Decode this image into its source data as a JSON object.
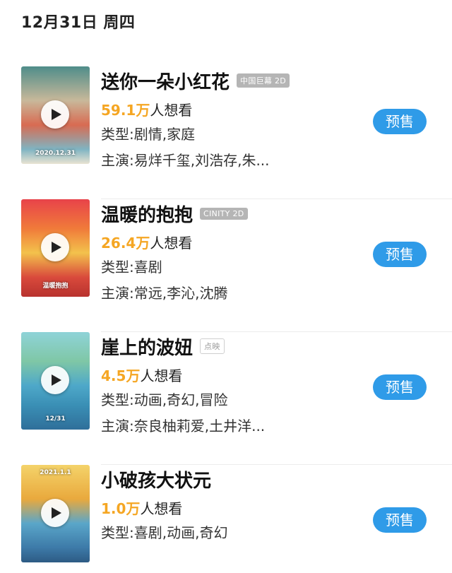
{
  "header": {
    "date": "12月31日 周四"
  },
  "movies": [
    {
      "title": "送你一朵小红花",
      "format": "中国巨幕 2D",
      "want_count": "59.1万",
      "want_suffix": "人想看",
      "genre": "类型:剧情,家庭",
      "cast": "主演:易烊千玺,刘浩存,朱...",
      "button": "预售",
      "poster_caption": "2020.12.31"
    },
    {
      "title": "温暖的抱抱",
      "format": "CINITY 2D",
      "want_count": "26.4万",
      "want_suffix": "人想看",
      "genre": "类型:喜剧",
      "cast": "主演:常远,李沁,沈腾",
      "button": "预售",
      "poster_caption": "温暖抱抱"
    },
    {
      "title": "崖上的波妞",
      "format": "点映",
      "want_count": "4.5万",
      "want_suffix": "人想看",
      "genre": "类型:动画,奇幻,冒险",
      "cast": "主演:奈良柚莉爱,土井洋...",
      "button": "预售",
      "poster_caption": "12/31"
    },
    {
      "title": "小破孩大状元",
      "format": "",
      "want_count": "1.0万",
      "want_suffix": "人想看",
      "genre": "类型:喜剧,动画,奇幻",
      "cast": "",
      "button": "预售",
      "poster_caption": "2021.1.1"
    }
  ],
  "colors": {
    "accent_orange": "#f5a623",
    "presale_blue": "#2f9be8"
  }
}
